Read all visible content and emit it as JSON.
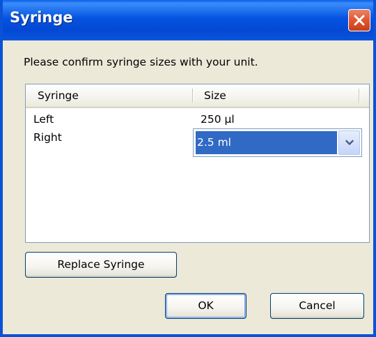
{
  "window": {
    "title": "Syringe"
  },
  "message": "Please confirm syringe sizes with your unit.",
  "table": {
    "columns": [
      "Syringe",
      "Size"
    ],
    "rows": [
      {
        "syringe": "Left",
        "size": "250 µl"
      },
      {
        "syringe": "Right",
        "size": "2.5 ml"
      }
    ]
  },
  "buttons": {
    "replace": "Replace Syringe",
    "ok": "OK",
    "cancel": "Cancel"
  },
  "icons": {
    "close": "close-icon",
    "dropdown": "chevron-down-icon"
  },
  "colors": {
    "titlebar": "#0a55dd",
    "close_button": "#e35a35",
    "selection": "#316ac5",
    "dialog_background": "#ece9d8"
  }
}
